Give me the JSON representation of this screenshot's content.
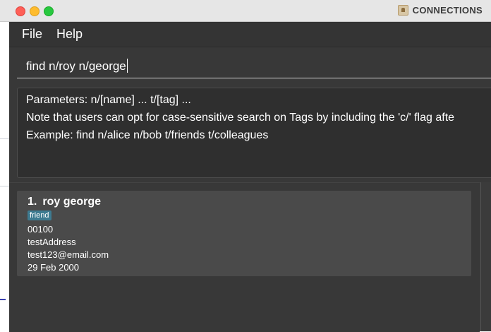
{
  "window": {
    "title": "CONNECTIONS"
  },
  "menu": {
    "file": "File",
    "help": "Help"
  },
  "command": {
    "value": "find n/roy n/george"
  },
  "result": {
    "lines": [
      "Parameters: n/[name] ... t/[tag] ...",
      "Note that users can opt for case-sensitive search on Tags by including the 'c/' flag afte",
      "Example: find n/alice n/bob t/friends t/colleagues"
    ]
  },
  "persons": [
    {
      "index": "1.",
      "name": "roy george",
      "tag": "friend",
      "phone": "00100",
      "address": "testAddress",
      "email": "test123@email.com",
      "date": "29 Feb 2000"
    }
  ],
  "colors": {
    "tag_bg": "#3e7b91",
    "panel_bg": "#383838",
    "card_bg": "#4a4a4a"
  }
}
